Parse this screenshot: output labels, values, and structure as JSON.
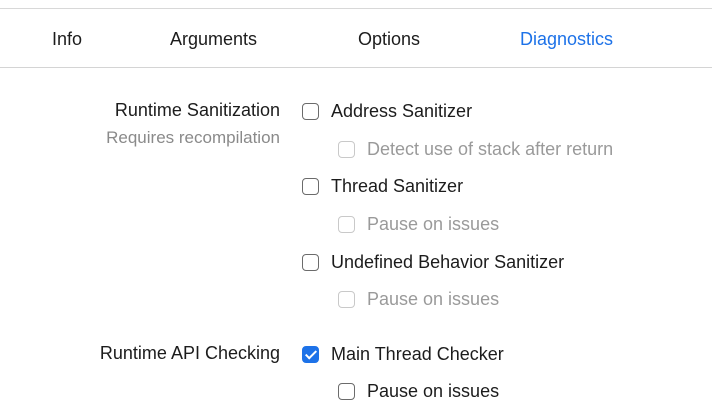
{
  "tabs": {
    "info": "Info",
    "arguments": "Arguments",
    "options": "Options",
    "diagnostics": "Diagnostics"
  },
  "runtime_sanitization": {
    "label": "Runtime Sanitization",
    "sublabel": "Requires recompilation",
    "address_sanitizer": {
      "label": "Address Sanitizer",
      "checked": false
    },
    "detect_stack_after_return": {
      "label": "Detect use of stack after return",
      "checked": false,
      "enabled": false
    },
    "thread_sanitizer": {
      "label": "Thread Sanitizer",
      "checked": false
    },
    "thread_pause_on_issues": {
      "label": "Pause on issues",
      "checked": false,
      "enabled": false
    },
    "ub_sanitizer": {
      "label": "Undefined Behavior Sanitizer",
      "checked": false
    },
    "ub_pause_on_issues": {
      "label": "Pause on issues",
      "checked": false,
      "enabled": false
    }
  },
  "runtime_api_checking": {
    "label": "Runtime API Checking",
    "main_thread_checker": {
      "label": "Main Thread Checker",
      "checked": true
    },
    "mtc_pause_on_issues": {
      "label": "Pause on issues",
      "checked": false,
      "enabled": true
    }
  },
  "colors": {
    "accent": "#1d72e8",
    "disabled_text": "#9a9a9a",
    "secondary_text": "#8a8a8a"
  }
}
